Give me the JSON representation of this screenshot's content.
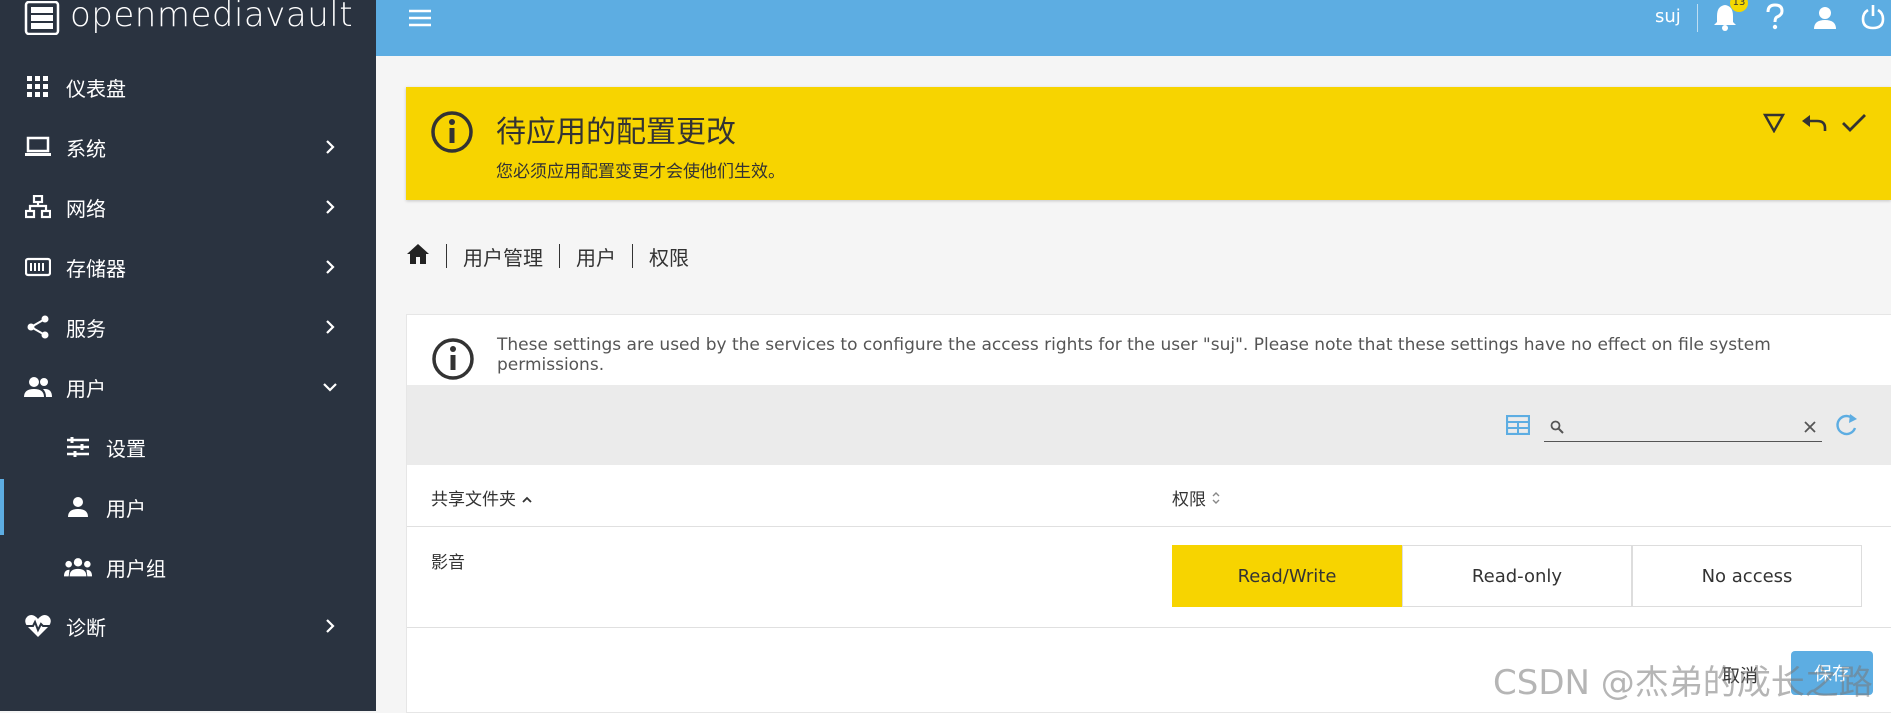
{
  "app": {
    "logo_text": "openmediavault"
  },
  "sidebar": {
    "items": [
      {
        "label": "仪表盘",
        "icon": "dashboard-icon"
      },
      {
        "label": "系统",
        "icon": "laptop-icon"
      },
      {
        "label": "网络",
        "icon": "network-icon"
      },
      {
        "label": "存储器",
        "icon": "storage-icon"
      },
      {
        "label": "服务",
        "icon": "share-icon"
      },
      {
        "label": "用户",
        "icon": "users-icon"
      },
      {
        "label": "设置",
        "icon": "tune-icon"
      },
      {
        "label": "用户",
        "icon": "user-icon"
      },
      {
        "label": "用户组",
        "icon": "group-icon"
      },
      {
        "label": "诊断",
        "icon": "heartbeat-icon"
      }
    ]
  },
  "topbar": {
    "user": "suj",
    "notification_count": "13"
  },
  "banner": {
    "title": "待应用的配置更改",
    "text": "您必须应用配置变更才会使他们生效。"
  },
  "breadcrumb": [
    "用户管理",
    "用户",
    "权限"
  ],
  "card": {
    "info": "These settings are used by the services to configure the access rights for the user \"suj\". Please note that these settings have no effect on file system permissions.",
    "columns": [
      "共享文件夹",
      "权限"
    ],
    "rows": [
      {
        "folder": "影音",
        "selected": "Read/Write"
      }
    ],
    "options": [
      "Read/Write",
      "Read-only",
      "No access"
    ],
    "cancel": "取消",
    "save": "保存"
  },
  "watermark": "CSDN @杰弟的成长之路",
  "colors": {
    "sidebar": "#2a3340",
    "topbar": "#5dade2",
    "banner": "#f7d400"
  }
}
